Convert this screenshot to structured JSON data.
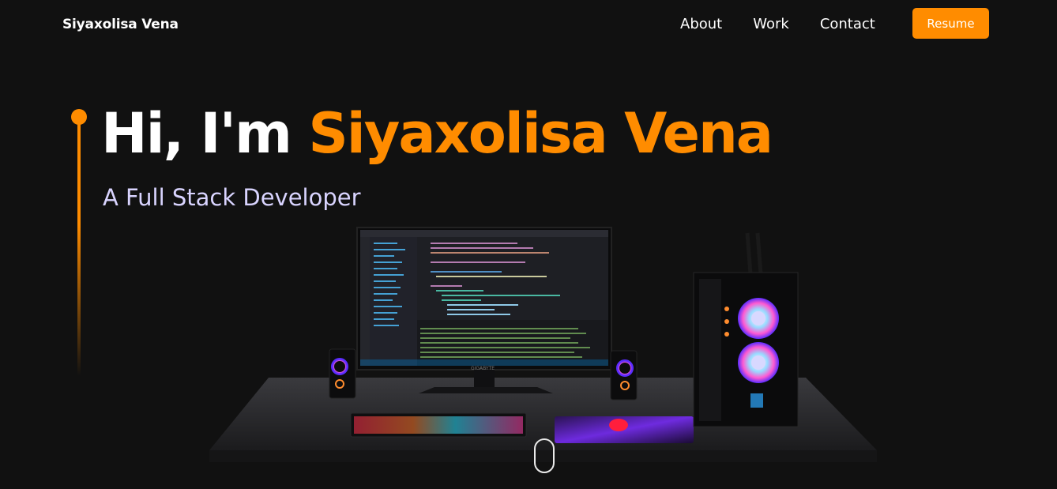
{
  "nav": {
    "brand": "Siyaxolisa Vena",
    "links": [
      "About",
      "Work",
      "Contact"
    ],
    "resume_label": "Resume"
  },
  "hero": {
    "greeting": "Hi, I'm",
    "name": "Siyaxolisa Vena",
    "subtitle": "A Full Stack Developer"
  },
  "colors": {
    "background": "#111111",
    "accent": "#ff8c00",
    "subtitle": "#d9d4ff"
  },
  "scene": {
    "monitor_brand": "GIGABYTE"
  },
  "icons": [
    "scroll-mouse-icon"
  ]
}
